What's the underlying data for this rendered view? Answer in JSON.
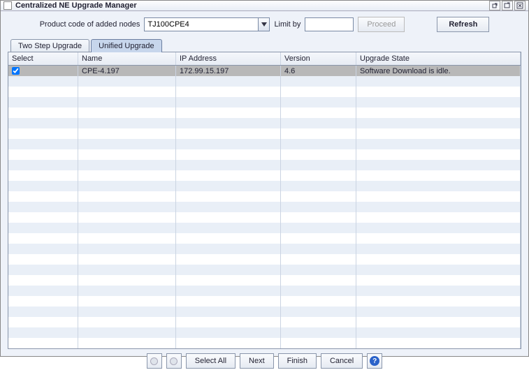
{
  "window": {
    "title": "Centralized NE Upgrade Manager"
  },
  "toolbar": {
    "product_code_label": "Product code of added nodes",
    "product_code_value": "TJ100CPE4",
    "limit_by_label": "Limit by",
    "limit_by_value": "",
    "proceed_label": "Proceed",
    "refresh_label": "Refresh"
  },
  "tabs": {
    "two_step": "Two Step Upgrade",
    "unified": "Unified Upgrade"
  },
  "columns": {
    "select": "Select",
    "name": "Name",
    "ip": "IP Address",
    "version": "Version",
    "state": "Upgrade State"
  },
  "rows": [
    {
      "checked": true,
      "name": "CPE-4.197",
      "ip": "172.99.15.197",
      "version": "4.6",
      "state": "Software Download is idle."
    }
  ],
  "footer": {
    "select_all": "Select All",
    "next": "Next",
    "finish": "Finish",
    "cancel": "Cancel"
  }
}
